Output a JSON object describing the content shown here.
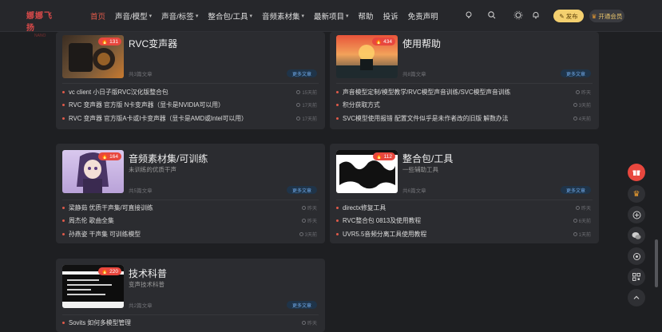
{
  "header": {
    "logo_line1": "娜娜飞扬",
    "logo_line2": "NANO",
    "nav": [
      {
        "label": "首页",
        "active": true,
        "caret": false
      },
      {
        "label": "声音/模型",
        "active": false,
        "caret": true
      },
      {
        "label": "声音/标签",
        "active": false,
        "caret": true
      },
      {
        "label": "整合包/工具",
        "active": false,
        "caret": true
      },
      {
        "label": "音频素材集",
        "active": false,
        "caret": true
      },
      {
        "label": "最新项目",
        "active": false,
        "caret": true
      },
      {
        "label": "帮助",
        "active": false,
        "caret": false
      },
      {
        "label": "投诉",
        "active": false,
        "caret": false
      },
      {
        "label": "免责声明",
        "active": false,
        "caret": false
      }
    ],
    "publish_label": "发布",
    "vip_label": "开通会员"
  },
  "cards": [
    {
      "title": "RVC变声器",
      "subtitle": "",
      "badge": "131",
      "count": "共3篇文章",
      "more": "更多文章",
      "posts": [
        {
          "text": "vc client 小日子版RVC汉化版整合包",
          "time": "15天前"
        },
        {
          "text": "RVC 变声器 官方版 N卡变声器（显卡是NVIDIA可以用）",
          "time": "17天前"
        },
        {
          "text": "RVC 变声器 官方版A卡或I卡变声器（显卡是AMD或Intel可以用）",
          "time": "17天前"
        }
      ]
    },
    {
      "title": "使用帮助",
      "subtitle": "",
      "badge": "434",
      "count": "共8篇文章",
      "more": "更多文章",
      "posts": [
        {
          "text": "声音模型定制/模型教学/RVC模型声音训练/SVC模型声音训练",
          "time": "昨天"
        },
        {
          "text": "积分获取方式",
          "time": "3天前"
        },
        {
          "text": "SVC模型使用报错 配置文件似乎是未作者改的旧版 解数办法",
          "time": "4天前"
        }
      ]
    },
    {
      "title": "音频素材集/可训练",
      "subtitle": "未训练的优质干声",
      "badge": "164",
      "count": "共5篇文章",
      "more": "更多文章",
      "posts": [
        {
          "text": "梁静茹 优质干声集/可直接训练",
          "time": "昨天"
        },
        {
          "text": "周杰伦 歌曲全集",
          "time": "昨天"
        },
        {
          "text": "孙燕姿 干声集 可训练模型",
          "time": "3天前"
        }
      ]
    },
    {
      "title": "整合包/工具",
      "subtitle": "一些辅助工具",
      "badge": "112",
      "count": "共6篇文章",
      "more": "更多文章",
      "posts": [
        {
          "text": "directx修复工具",
          "time": "昨天"
        },
        {
          "text": "RVC整合包 0813及使用教程",
          "time": "6天前"
        },
        {
          "text": "UVR5.5音频分离工具使用教程",
          "time": "1天前"
        }
      ]
    },
    {
      "title": "技术科普",
      "subtitle": "变声技术科普",
      "badge": "220",
      "count": "共2篇文章",
      "more": "更多文章",
      "posts": [
        {
          "text": "Sovits 如何多模型管理",
          "time": "昨天"
        }
      ]
    }
  ],
  "colors": {
    "accent": "#e05a4a",
    "badge": "#e8473e",
    "publish": "#f4d06f",
    "link_blue": "#6fa8e6"
  }
}
